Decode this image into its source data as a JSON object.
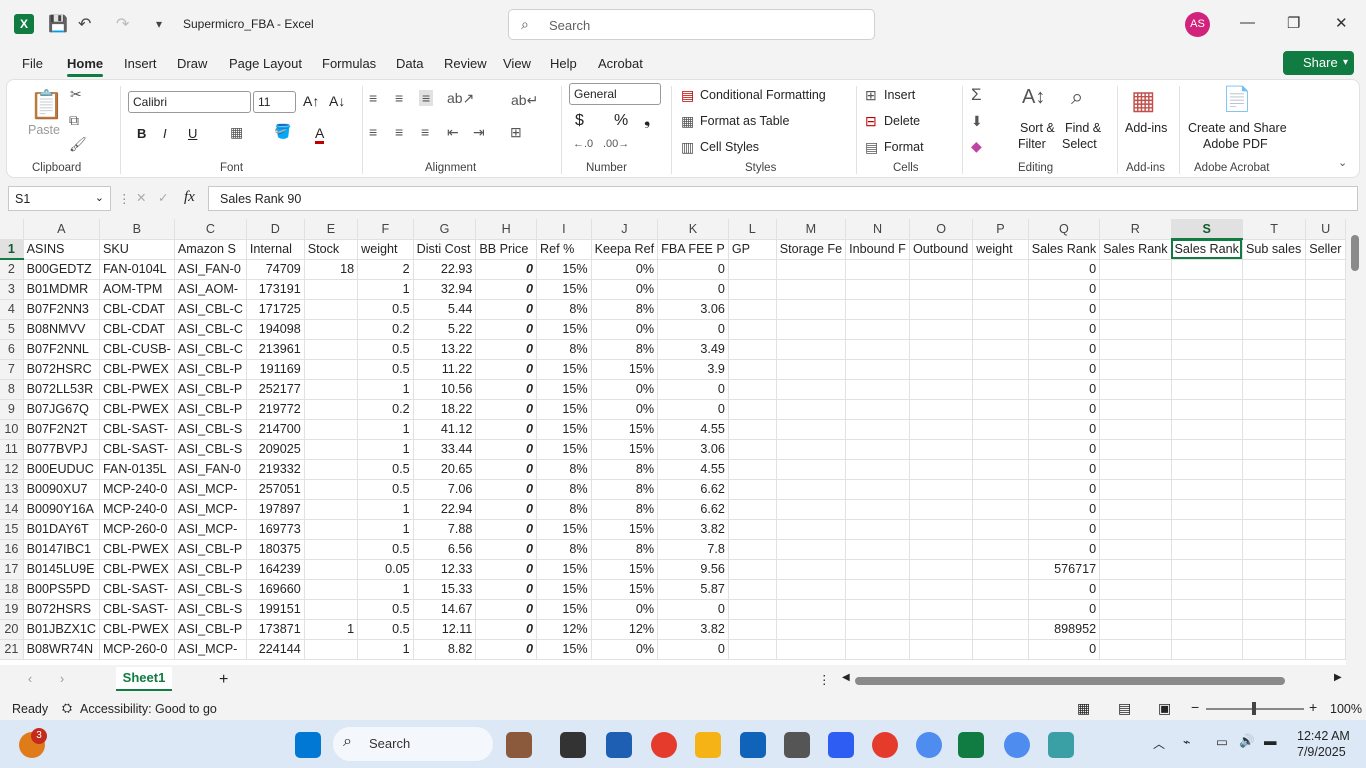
{
  "window": {
    "title": "Supermicro_FBA  -  Excel",
    "search_placeholder": "Search",
    "user_initials": "AS"
  },
  "tabs": [
    "File",
    "Home",
    "Insert",
    "Draw",
    "Page Layout",
    "Formulas",
    "Data",
    "Review",
    "View",
    "Help",
    "Acrobat"
  ],
  "share": "Share",
  "ribbon": {
    "clipboard": {
      "paste": "Paste",
      "label": "Clipboard"
    },
    "font": {
      "name": "Calibri",
      "size": "11",
      "label": "Font"
    },
    "alignment": {
      "label": "Alignment"
    },
    "number": {
      "format": "General",
      "label": "Number"
    },
    "styles": {
      "conditional": "Conditional Formatting",
      "format_table": "Format as Table",
      "cell_styles": "Cell Styles",
      "label": "Styles"
    },
    "cells": {
      "insert": "Insert",
      "delete": "Delete",
      "format": "Format",
      "label": "Cells"
    },
    "editing": {
      "sort1": "Sort &",
      "sort2": "Filter",
      "find1": "Find &",
      "find2": "Select",
      "label": "Editing"
    },
    "addins": {
      "btn": "Add-ins",
      "label": "Add-ins"
    },
    "acrobat": {
      "btn1": "Create and Share",
      "btn2": "Adobe PDF",
      "label": "Adobe Acrobat"
    }
  },
  "namebox": "S1",
  "formula": "Sales Rank 90",
  "columns": [
    "A",
    "B",
    "C",
    "D",
    "E",
    "F",
    "G",
    "H",
    "I",
    "J",
    "K",
    "L",
    "M",
    "N",
    "O",
    "P",
    "Q",
    "R",
    "S",
    "T",
    "U"
  ],
  "col_widths": [
    64,
    64,
    64,
    64,
    64,
    64,
    64,
    64,
    64,
    64,
    64,
    64,
    64,
    64,
    64,
    64,
    64,
    64,
    64,
    64,
    40
  ],
  "headers": [
    "ASINS",
    "SKU",
    "Amazon S",
    "Internal",
    "Stock",
    "weight",
    "Disti Cost",
    "BB Price",
    "Ref %",
    "Keepa Ref",
    "FBA FEE P",
    "GP",
    "Storage Fe",
    "Inbound F",
    "Outbound",
    "weight",
    "Sales Rank",
    "Sales Rank",
    "Sales Rank",
    "Sub sales",
    "Seller"
  ],
  "rows": [
    [
      "2",
      "B00GEDTZ",
      "FAN-0104L",
      "ASI_FAN-0",
      "74709",
      "18",
      "2",
      "22.93",
      "0",
      "15%",
      "0%",
      "0",
      "",
      "",
      "",
      "",
      "",
      "0",
      "",
      "",
      "",
      ""
    ],
    [
      "3",
      "B01MDMR",
      "AOM-TPM",
      "ASI_AOM-",
      "173191",
      "",
      "1",
      "32.94",
      "0",
      "15%",
      "0%",
      "0",
      "",
      "",
      "",
      "",
      "",
      "0",
      "",
      "",
      "",
      ""
    ],
    [
      "4",
      "B07F2NN3",
      "CBL-CDAT",
      "ASI_CBL-C",
      "171725",
      "",
      "0.5",
      "5.44",
      "0",
      "8%",
      "8%",
      "3.06",
      "",
      "",
      "",
      "",
      "",
      "0",
      "",
      "",
      "",
      ""
    ],
    [
      "5",
      "B08NMVV",
      "CBL-CDAT",
      "ASI_CBL-C",
      "194098",
      "",
      "0.2",
      "5.22",
      "0",
      "15%",
      "0%",
      "0",
      "",
      "",
      "",
      "",
      "",
      "0",
      "",
      "",
      "",
      ""
    ],
    [
      "6",
      "B07F2NNL",
      "CBL-CUSB-",
      "ASI_CBL-C",
      "213961",
      "",
      "0.5",
      "13.22",
      "0",
      "8%",
      "8%",
      "3.49",
      "",
      "",
      "",
      "",
      "",
      "0",
      "",
      "",
      "",
      ""
    ],
    [
      "7",
      "B072HSRC",
      "CBL-PWEX",
      "ASI_CBL-P",
      "191169",
      "",
      "0.5",
      "11.22",
      "0",
      "15%",
      "15%",
      "3.9",
      "",
      "",
      "",
      "",
      "",
      "0",
      "",
      "",
      "",
      ""
    ],
    [
      "8",
      "B072LL53R",
      "CBL-PWEX",
      "ASI_CBL-P",
      "252177",
      "",
      "1",
      "10.56",
      "0",
      "15%",
      "0%",
      "0",
      "",
      "",
      "",
      "",
      "",
      "0",
      "",
      "",
      "",
      ""
    ],
    [
      "9",
      "B07JG67Q",
      "CBL-PWEX",
      "ASI_CBL-P",
      "219772",
      "",
      "0.2",
      "18.22",
      "0",
      "15%",
      "0%",
      "0",
      "",
      "",
      "",
      "",
      "",
      "0",
      "",
      "",
      "",
      ""
    ],
    [
      "10",
      "B07F2N2T",
      "CBL-SAST-",
      "ASI_CBL-S",
      "214700",
      "",
      "1",
      "41.12",
      "0",
      "15%",
      "15%",
      "4.55",
      "",
      "",
      "",
      "",
      "",
      "0",
      "",
      "",
      "",
      ""
    ],
    [
      "11",
      "B077BVPJ",
      "CBL-SAST-",
      "ASI_CBL-S",
      "209025",
      "",
      "1",
      "33.44",
      "0",
      "15%",
      "15%",
      "3.06",
      "",
      "",
      "",
      "",
      "",
      "0",
      "",
      "",
      "",
      ""
    ],
    [
      "12",
      "B00EUDUC",
      "FAN-0135L",
      "ASI_FAN-0",
      "219332",
      "",
      "0.5",
      "20.65",
      "0",
      "8%",
      "8%",
      "4.55",
      "",
      "",
      "",
      "",
      "",
      "0",
      "",
      "",
      "",
      ""
    ],
    [
      "13",
      "B0090XU7",
      "MCP-240-0",
      "ASI_MCP-",
      "257051",
      "",
      "0.5",
      "7.06",
      "0",
      "8%",
      "8%",
      "6.62",
      "",
      "",
      "",
      "",
      "",
      "0",
      "",
      "",
      "",
      ""
    ],
    [
      "14",
      "B0090Y16A",
      "MCP-240-0",
      "ASI_MCP-",
      "197897",
      "",
      "1",
      "22.94",
      "0",
      "8%",
      "8%",
      "6.62",
      "",
      "",
      "",
      "",
      "",
      "0",
      "",
      "",
      "",
      ""
    ],
    [
      "15",
      "B01DAY6T",
      "MCP-260-0",
      "ASI_MCP-",
      "169773",
      "",
      "1",
      "7.88",
      "0",
      "15%",
      "15%",
      "3.82",
      "",
      "",
      "",
      "",
      "",
      "0",
      "",
      "",
      "",
      ""
    ],
    [
      "16",
      "B0147IBC1",
      "CBL-PWEX",
      "ASI_CBL-P",
      "180375",
      "",
      "0.5",
      "6.56",
      "0",
      "8%",
      "8%",
      "7.8",
      "",
      "",
      "",
      "",
      "",
      "0",
      "",
      "",
      "",
      ""
    ],
    [
      "17",
      "B0145LU9E",
      "CBL-PWEX",
      "ASI_CBL-P",
      "164239",
      "",
      "0.05",
      "12.33",
      "0",
      "15%",
      "15%",
      "9.56",
      "",
      "",
      "",
      "",
      "",
      "576717",
      "",
      "",
      "",
      ""
    ],
    [
      "18",
      "B00PS5PD",
      "CBL-SAST-",
      "ASI_CBL-S",
      "169660",
      "",
      "1",
      "15.33",
      "0",
      "15%",
      "15%",
      "5.87",
      "",
      "",
      "",
      "",
      "",
      "0",
      "",
      "",
      "",
      ""
    ],
    [
      "19",
      "B072HSRS",
      "CBL-SAST-",
      "ASI_CBL-S",
      "199151",
      "",
      "0.5",
      "14.67",
      "0",
      "15%",
      "0%",
      "0",
      "",
      "",
      "",
      "",
      "",
      "0",
      "",
      "",
      "",
      ""
    ],
    [
      "20",
      "B01JBZX1C",
      "CBL-PWEX",
      "ASI_CBL-P",
      "173871",
      "1",
      "0.5",
      "12.11",
      "0",
      "12%",
      "12%",
      "3.82",
      "",
      "",
      "",
      "",
      "",
      "898952",
      "",
      "",
      "",
      ""
    ],
    [
      "21",
      "B08WR74N",
      "MCP-260-0",
      "ASI_MCP-",
      "224144",
      "",
      "1",
      "8.82",
      "0",
      "15%",
      "0%",
      "0",
      "",
      "",
      "",
      "",
      "",
      "0",
      "",
      "",
      "",
      ""
    ]
  ],
  "sheet": "Sheet1",
  "status": {
    "ready": "Ready",
    "accessibility": "Accessibility: Good to go",
    "zoom": "100%"
  },
  "taskbar": {
    "search": "Search",
    "time": "12:42 AM",
    "date": "7/9/2025",
    "badge": "3"
  }
}
